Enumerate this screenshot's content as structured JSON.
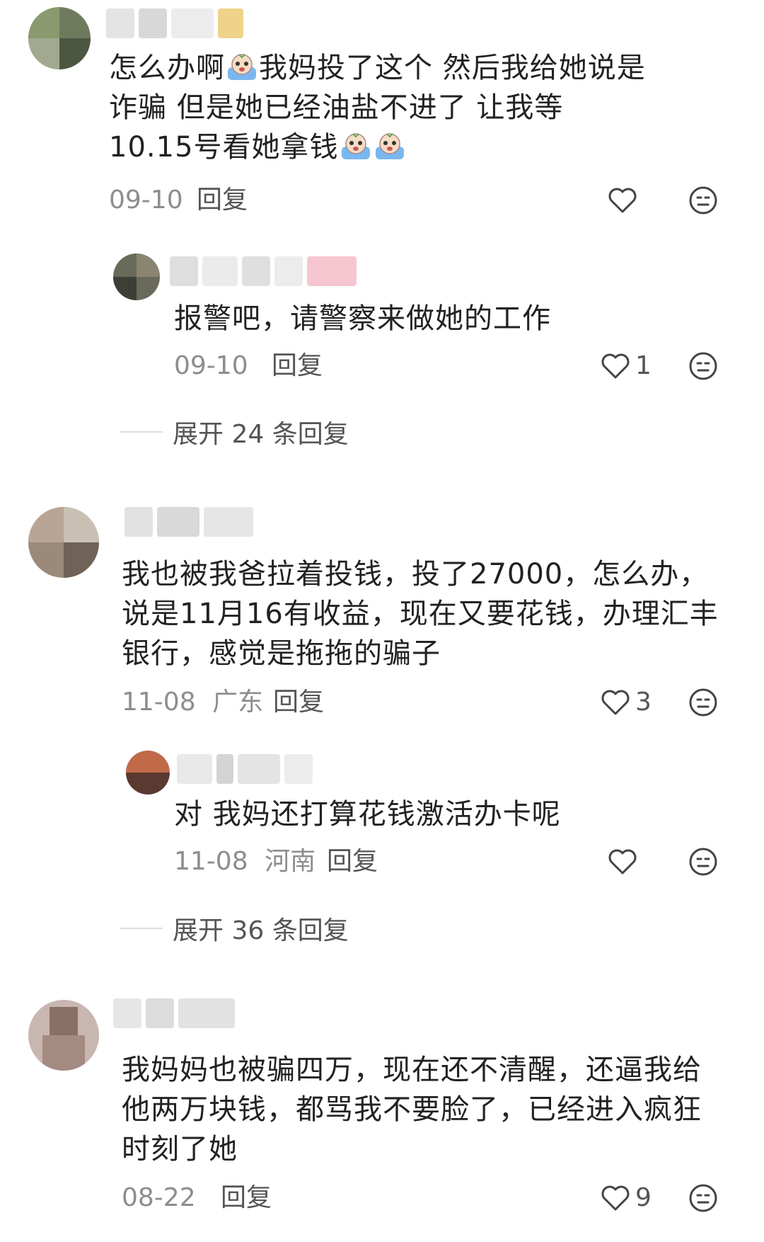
{
  "comments": [
    {
      "text_parts": [
        "怎么办啊",
        "我妈投了这个 然后我给她说是诈骗 但是她已经油盐不进了 让我等10.15号看她拿钱"
      ],
      "date": "09-10",
      "reply_label": "回复",
      "reply": {
        "text": "报警吧，请警察来做她的工作",
        "date": "09-10",
        "reply_label": "回复",
        "likes": "1"
      },
      "expand_label": "展开 24 条回复"
    },
    {
      "text": "我也被我爸拉着投钱，投了27000，怎么办，说是11月16有收益，现在又要花钱，办理汇丰银行，感觉是拖拖的骗子",
      "date": "11-08",
      "location": "广东",
      "reply_label": "回复",
      "likes": "3",
      "reply": {
        "text": "对 我妈还打算花钱激活办卡呢",
        "date": "11-08",
        "location": "河南",
        "reply_label": "回复"
      },
      "expand_label": "展开 36 条回复"
    },
    {
      "text": "我妈妈也被骗四万，现在还不清醒，还逼我给他两万块钱，都骂我不要脸了，已经进入疯狂时刻了她",
      "date": "08-22",
      "reply_label": "回复",
      "likes": "9"
    }
  ],
  "icons": {
    "like": "heart-outline-icon",
    "dislike": "meh-face-icon",
    "emoji": "crying-emoji-icon"
  },
  "colors": {
    "text": "#222222",
    "meta": "#8d8d8d",
    "icon": "#444444"
  }
}
